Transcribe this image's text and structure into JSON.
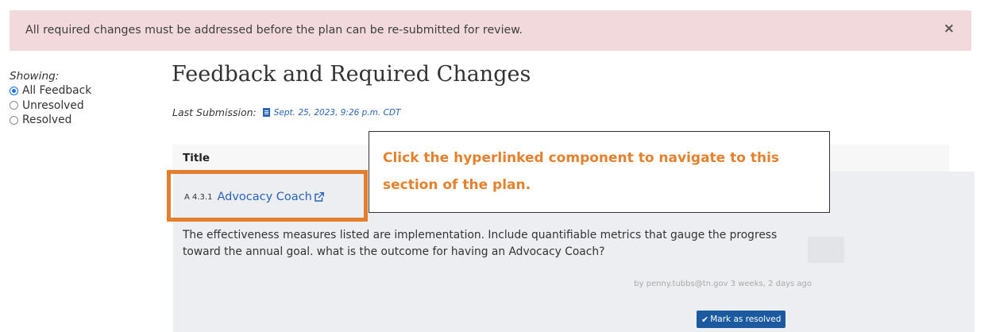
{
  "alert": {
    "message": "All required changes must be addressed before the plan can be re-submitted for review.",
    "close": "×"
  },
  "filter": {
    "label": "Showing:",
    "options": [
      {
        "label": "All Feedback",
        "checked": true
      },
      {
        "label": "Unresolved",
        "checked": false
      },
      {
        "label": "Resolved",
        "checked": false
      }
    ]
  },
  "page": {
    "title": "Feedback and Required Changes",
    "last_submission_label": "Last Submission:",
    "last_submission_date": "Sept. 25, 2023, 9:26 p.m. CDT"
  },
  "table": {
    "column_title": "Title"
  },
  "feedback_item": {
    "component_code": "A 4.3.1",
    "component_name": "Advocacy Coach",
    "text": "The effectiveness measures listed are implementation. Include quantifiable metrics that gauge the progress toward the annual goal. what is the outcome for having an Advocacy Coach?",
    "byline": "by penny.tubbs@tn.gov 3 weeks, 2 days ago",
    "resolve_button": "Mark as resolved"
  },
  "annotation": {
    "callout_text": "Click the hyperlinked component to navigate to this section of the plan.",
    "highlight_color": "#e27e2d",
    "text_color": "#e4812e"
  },
  "colors": {
    "alert_bg": "#f2d9dc",
    "link": "#2a64b8",
    "button_bg": "#1b5a9e",
    "row_bg": "#eceef2"
  },
  "icons": {
    "document": "document-icon",
    "external_link": "external-link-icon",
    "check": "check-icon",
    "close": "close-icon"
  }
}
